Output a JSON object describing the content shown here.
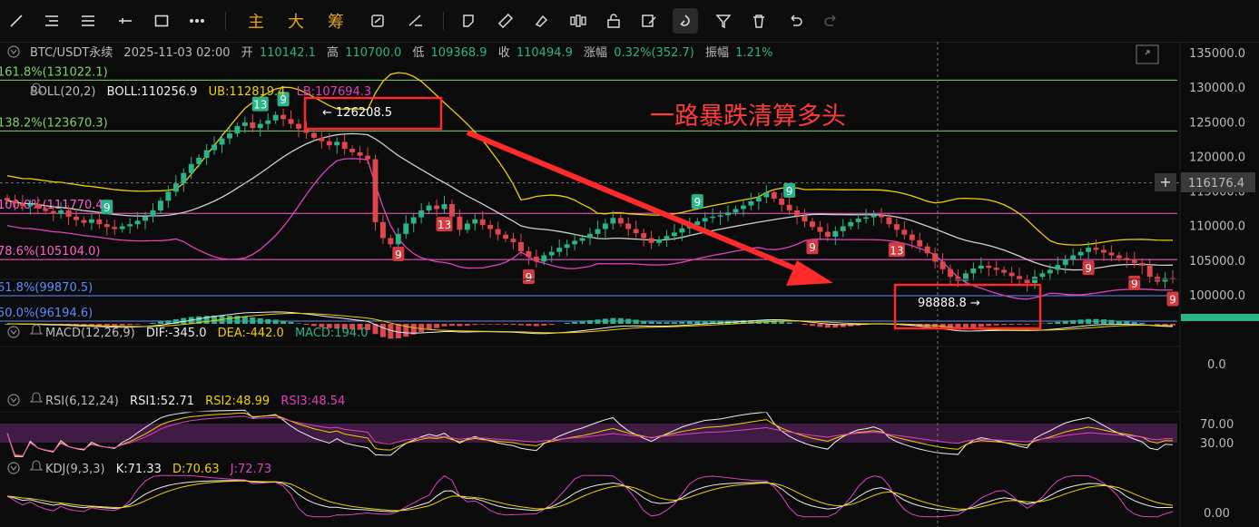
{
  "toolbar": {
    "tools": [
      "trendline-icon",
      "horizontal-lines-icon",
      "parallel-lines-icon",
      "horizontal-ray-icon",
      "rectangle-icon",
      "more-icon"
    ],
    "indicator_main": "主",
    "indicator_large": "大",
    "indicator_chips": "筹",
    "tools_right": [
      "sync-icon",
      "measure-icon",
      "pencil-icon",
      "text-icon",
      "ruler-icon",
      "eraser-icon",
      "pattern-icon",
      "lock-icon",
      "edit-icon",
      "magnet-icon",
      "filter-icon",
      "trash-icon",
      "undo-icon",
      "redo-icon"
    ]
  },
  "header": {
    "symbol": "BTC/USDT永续",
    "datetime": "2025-11-03 02:00",
    "open_label": "开",
    "open": "110142.1",
    "high_label": "高",
    "high": "110700.0",
    "low_label": "低",
    "low": "109368.9",
    "close_label": "收",
    "close": "110494.9",
    "change_label": "涨幅",
    "change": "0.32%(352.7)",
    "amp_label": "振幅",
    "amp": "1.21%"
  },
  "boll": {
    "label": "BOLL(20,2)",
    "mid": "BOLL:110256.9",
    "ub": "UB:112819.4",
    "lb": "LB:107694.3"
  },
  "fib": [
    {
      "text": "161.8%(131022.1)",
      "price": 131022.1,
      "color": "#7fd36a"
    },
    {
      "text": "138.2%(123670.3)",
      "price": 123670.3,
      "color": "#7fd36a"
    },
    {
      "text": "100.0%(111770.4)",
      "price": 111770.4,
      "color": "#ff5fd1"
    },
    {
      "text": "78.6%(105104.0)",
      "price": 105104.0,
      "color": "#ff5fd1"
    },
    {
      "text": "61.8%(99870.5)",
      "price": 99870.5,
      "color": "#5b8cff"
    },
    {
      "text": "50.0%(96194.6)",
      "price": 96194.6,
      "color": "#5b8cff"
    }
  ],
  "annotations": {
    "headline": "一路暴跌清算多头",
    "high_marker": "← 126208.5",
    "low_marker": "98888.8 →",
    "crosshair_price": "116176.4"
  },
  "macd": {
    "label": "MACD(12,26,9)",
    "dif": "DIF:-345.0",
    "dea": "DEA:-442.0",
    "macd": "MACD:194.0",
    "axis": [
      "0.0"
    ]
  },
  "rsi": {
    "label": "RSI(6,12,24)",
    "rsi1": "RSI1:52.71",
    "rsi2": "RSI2:48.99",
    "rsi3": "RSI3:48.54",
    "axis": [
      "70.00",
      "30.00"
    ]
  },
  "kdj": {
    "label": "KDJ(9,3,3)",
    "k": "K:71.33",
    "d": "D:70.63",
    "j": "J:72.73",
    "axis": [
      "0.00"
    ]
  },
  "td_labels": [
    {
      "text": "9",
      "pos": "above"
    },
    {
      "text": "13",
      "pos": "above"
    },
    {
      "text": "9",
      "pos": "above"
    },
    {
      "text": "9",
      "pos": "below"
    },
    {
      "text": "13",
      "pos": "below"
    },
    {
      "text": "9",
      "pos": "below"
    },
    {
      "text": "9",
      "pos": "above"
    },
    {
      "text": "9",
      "pos": "above"
    },
    {
      "text": "9",
      "pos": "below"
    },
    {
      "text": "13",
      "pos": "below"
    },
    {
      "text": "9",
      "pos": "below"
    },
    {
      "text": "9",
      "pos": "below"
    },
    {
      "text": "9",
      "pos": "below"
    }
  ],
  "colors": {
    "up": "#2bb38a",
    "down": "#e0474c",
    "boll_mid": "#cfcfcf",
    "boll_ub": "#f0d000",
    "boll_lb": "#e040c0",
    "arrow": "#ff3030",
    "box": "#ff3030"
  },
  "chart_data": {
    "type": "candlestick",
    "title": "BTC/USDT永续",
    "y_ticks": [
      135000,
      130000,
      125000,
      120000,
      115000,
      110000,
      105000,
      100000
    ],
    "ylim": [
      95000,
      137000
    ],
    "closes": [
      113600,
      113200,
      112800,
      113100,
      112500,
      112100,
      111700,
      112200,
      111300,
      110800,
      110400,
      110900,
      110200,
      109800,
      109500,
      109900,
      110200,
      110700,
      111300,
      112200,
      113600,
      114900,
      116100,
      117600,
      118900,
      119800,
      120900,
      121700,
      122600,
      123300,
      124400,
      124900,
      124100,
      124700,
      125200,
      126000,
      125400,
      124700,
      124000,
      123400,
      122700,
      122200,
      121600,
      122100,
      121100,
      120600,
      120100,
      119600,
      110500,
      108200,
      107300,
      108800,
      110300,
      111200,
      112200,
      112900,
      112400,
      113100,
      111300,
      109400,
      110300,
      110900,
      110100,
      109500,
      108700,
      108100,
      107600,
      106300,
      105500,
      104800,
      105700,
      106200,
      106800,
      107300,
      107800,
      108200,
      108800,
      109500,
      110300,
      111100,
      110300,
      109500,
      108900,
      108200,
      107500,
      108000,
      108500,
      109000,
      109600,
      110100,
      110600,
      111100,
      111300,
      111500,
      111900,
      112400,
      112900,
      113500,
      114100,
      114800,
      113900,
      113000,
      112200,
      111400,
      110600,
      109800,
      109100,
      108400,
      109200,
      109900,
      110500,
      111000,
      111200,
      111500,
      111200,
      110200,
      109400,
      108700,
      107900,
      107000,
      106000,
      104800,
      103700,
      102600,
      102000,
      103100,
      103800,
      104200,
      103900,
      103600,
      103200,
      102700,
      102200,
      101700,
      102600,
      103100,
      103600,
      104300,
      105100,
      105700,
      106200,
      106800,
      106500,
      106100,
      105700,
      105300,
      105000,
      104600,
      104200,
      102600,
      101900,
      102400,
      102300
    ]
  }
}
